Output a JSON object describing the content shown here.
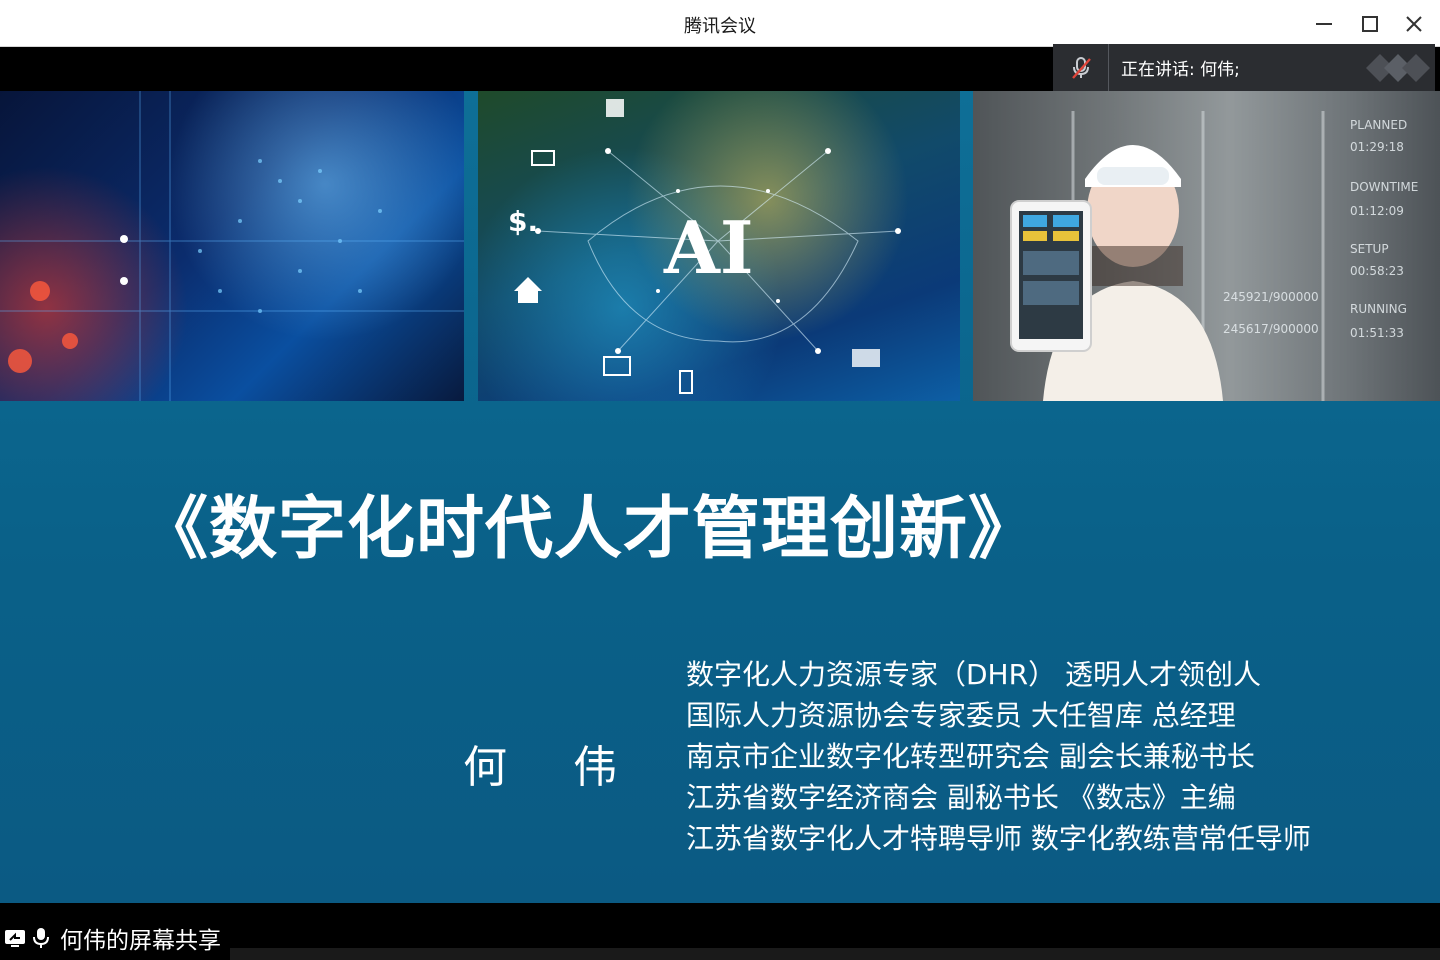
{
  "window": {
    "title": "腾讯会议"
  },
  "speaker_banner": {
    "text": "正在讲话: 何伟;"
  },
  "slide": {
    "title": "《数字化时代人才管理创新》",
    "presenter": "何 伟",
    "credentials": [
      "数字化人力资源专家（DHR）   透明人才领创人",
      "国际人力资源协会专家委员    大任智库 总经理",
      "南京市企业数字化转型研究会   副会长兼秘书长",
      "江苏省数字经济商会 副秘书长 《数志》主编",
      "江苏省数字化人才特聘导师  数字化教练营常任导师"
    ]
  },
  "screen_share": {
    "label": "何伟的屏幕共享"
  },
  "colors": {
    "slide_blue": "#0e6f97",
    "banner_bg": "#2b2d31",
    "mic_off_red": "#e0453a"
  },
  "icons": [
    "minimize-icon",
    "maximize-icon",
    "close-icon",
    "mic-off-icon",
    "screen-share-icon",
    "mic-icon",
    "tencent-meeting-logo"
  ]
}
